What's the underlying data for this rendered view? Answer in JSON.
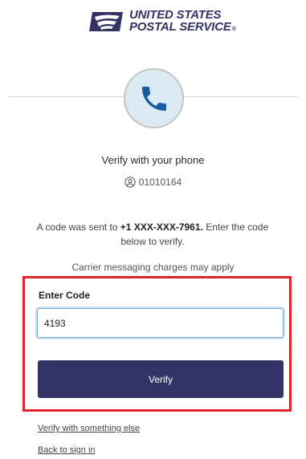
{
  "logo": {
    "line1": "UNITED STATES",
    "line2": "POSTAL SERVICE",
    "reg_mark": "®",
    "brand_color": "#333366"
  },
  "phone_icon": "phone-icon",
  "title": "Verify with your phone",
  "user": {
    "icon": "user-circle-icon",
    "id": "01010164"
  },
  "message": {
    "prefix": "A code was sent to ",
    "phone": "+1 XXX-XXX-7961.",
    "suffix": " Enter the code below to verify."
  },
  "charges_note": "Carrier messaging charges may apply",
  "code_field": {
    "label": "Enter Code",
    "value": "4193"
  },
  "verify_button": {
    "label": "Verify",
    "color": "#333366"
  },
  "links": {
    "verify_else": "Verify with something else",
    "back": "Back to sign in"
  },
  "highlight_color": "#e0242b"
}
